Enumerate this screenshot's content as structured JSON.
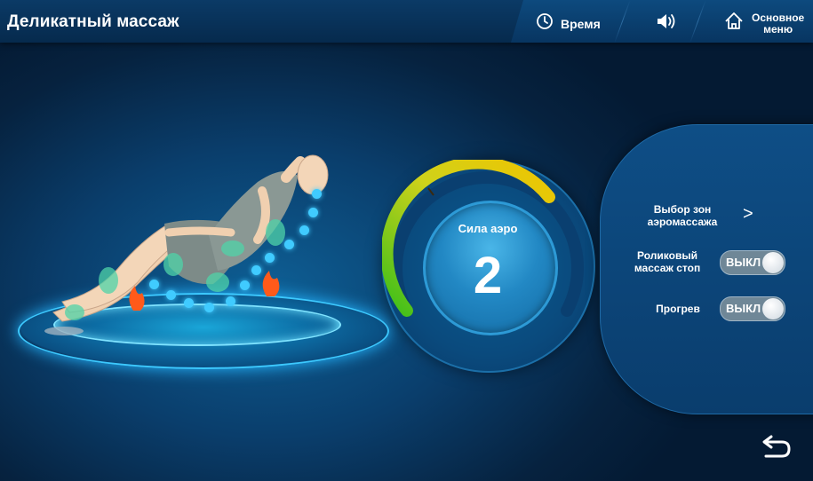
{
  "header": {
    "title": "Деликатный массаж",
    "time_label": "Время",
    "home_label_line1": "Основное",
    "home_label_line2": "меню"
  },
  "dial": {
    "label": "Сила аэро",
    "value": "2",
    "level_fraction": 0.5
  },
  "options": {
    "zones_line1": "Выбор зон",
    "zones_line2": "аэромассажа",
    "roller_line1": "Роликовый",
    "roller_line2": "массаж стоп",
    "roller_state": "ВЫКЛ",
    "heat_label": "Прогрев",
    "heat_state": "ВЫКЛ"
  },
  "icons": {
    "clock": "clock-icon",
    "volume": "volume-icon",
    "home": "home-icon",
    "back": "back-arrow-icon",
    "chevron": ">"
  },
  "colors": {
    "accent": "#40cbff",
    "gauge_green": "#4cc619",
    "gauge_yellow": "#f0c400",
    "toggle_off": "#6f8797"
  }
}
